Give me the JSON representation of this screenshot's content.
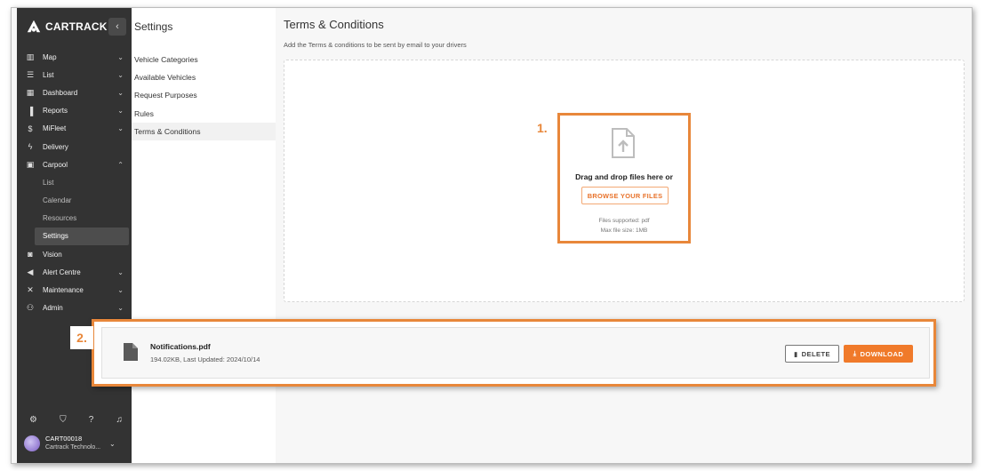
{
  "brand": {
    "name": "CARTRACK"
  },
  "sidebar": {
    "collapse_icon": "chevron-left-icon",
    "items": [
      {
        "label": "Map",
        "icon": "map-icon",
        "chevron": true
      },
      {
        "label": "List",
        "icon": "list-icon",
        "chevron": true
      },
      {
        "label": "Dashboard",
        "icon": "dashboard-icon",
        "chevron": true
      },
      {
        "label": "Reports",
        "icon": "bar-chart-icon",
        "chevron": true
      },
      {
        "label": "MiFleet",
        "icon": "dollar-icon",
        "chevron": true
      },
      {
        "label": "Delivery",
        "icon": "bolt-icon",
        "chevron": false
      },
      {
        "label": "Carpool",
        "icon": "calendar-icon",
        "chevron": true,
        "expanded": true
      }
    ],
    "carpool_sub": [
      {
        "label": "List"
      },
      {
        "label": "Calendar"
      },
      {
        "label": "Resources"
      },
      {
        "label": "Settings",
        "active": true
      }
    ],
    "items_after": [
      {
        "label": "Vision",
        "icon": "video-icon",
        "chevron": false
      },
      {
        "label": "Alert Centre",
        "icon": "megaphone-icon",
        "chevron": true
      },
      {
        "label": "Maintenance",
        "icon": "tools-icon",
        "chevron": true
      },
      {
        "label": "Admin",
        "icon": "admin-icon",
        "chevron": true
      }
    ],
    "bottom_icons": [
      "gear-icon",
      "shield-icon",
      "help-icon",
      "bell-icon"
    ],
    "user": {
      "name": "CART00018",
      "org": "Cartrack Technolo..."
    }
  },
  "settings": {
    "title": "Settings",
    "items": [
      {
        "label": "Vehicle Categories"
      },
      {
        "label": "Available Vehicles"
      },
      {
        "label": "Request Purposes"
      },
      {
        "label": "Rules"
      },
      {
        "label": "Terms & Conditions",
        "active": true
      }
    ]
  },
  "main": {
    "title": "Terms & Conditions",
    "subtitle": "Add the Terms & conditions to be sent by email to your drivers",
    "dropzone": {
      "marker": "1.",
      "text": "Drag and drop files here or",
      "browse_label": "BROWSE YOUR FILES",
      "supported": "Files supported: pdf",
      "max_size": "Max file size: 1MB"
    },
    "file": {
      "marker": "2.",
      "name": "Notifications.pdf",
      "meta": "194.02KB, Last Updated: 2024/10/14",
      "delete_label": "DELETE",
      "download_label": "DOWNLOAD"
    }
  },
  "colors": {
    "accent": "#f07a2a",
    "highlight": "#e8873a",
    "sidebar_bg": "#333333"
  }
}
